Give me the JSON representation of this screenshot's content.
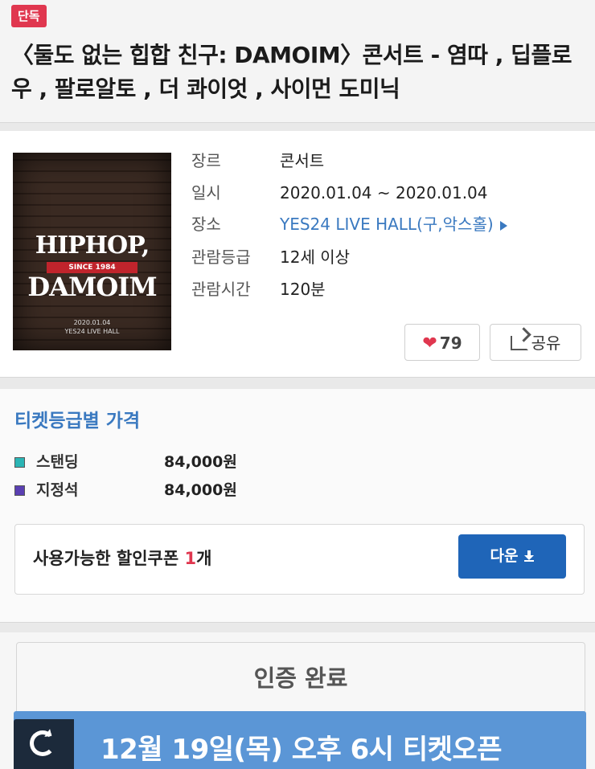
{
  "header": {
    "badge": "단독",
    "title": "〈둘도 없는 힙합 친구: DAMOIM〉콘서트 - 염따 , 딥플로우 , 팔로알토 , 더 콰이엇 , 사이먼 도미닉"
  },
  "poster": {
    "line1": "HIPHOP,",
    "since": "SINCE 1984",
    "line2": "DAMOIM",
    "date": "2020.01.04",
    "venue": "YES24 LIVE HALL"
  },
  "info": {
    "genre_label": "장르",
    "genre": "콘서트",
    "date_label": "일시",
    "date": "2020.01.04 ~ 2020.01.04",
    "place_label": "장소",
    "place": "YES24 LIVE HALL(구,악스홀)",
    "rating_label": "관람등급",
    "rating": "12세 이상",
    "runtime_label": "관람시간",
    "runtime": "120분"
  },
  "actions": {
    "like_count": "79",
    "share_label": "공유",
    "heart_icon": "heart-icon",
    "share_icon": "share-icon"
  },
  "prices": {
    "title": "티켓등급별 가격",
    "items": [
      {
        "name": "스탠딩",
        "price": "84,000원",
        "color": "#2bb5b5"
      },
      {
        "name": "지정석",
        "price": "84,000원",
        "color": "#5a3fb2"
      }
    ]
  },
  "coupon": {
    "text_before": "사용가능한 할인쿠폰 ",
    "count": "1",
    "text_after": "개",
    "download_label": "다운"
  },
  "auth": {
    "label": "인증 완료"
  },
  "open": {
    "text": "12월 19일(목) 오후 6시 티켓오픈"
  },
  "colors": {
    "accent_blue": "#1f65b8",
    "link_blue": "#3a79c0",
    "badge_red": "#e0374f",
    "open_bar": "#5b96d6"
  }
}
